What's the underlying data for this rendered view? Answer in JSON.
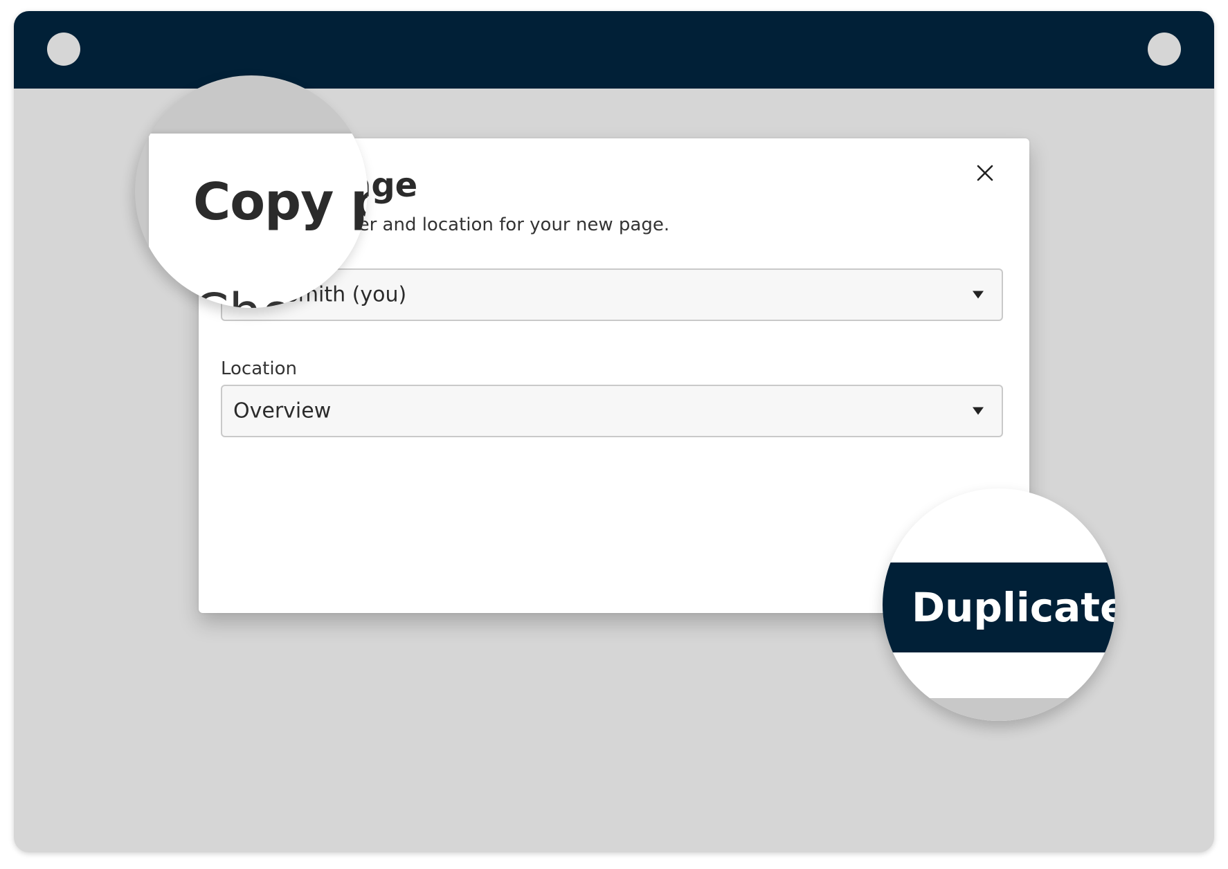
{
  "modal": {
    "title": "Copy page",
    "description": "Choose an owner and location for your new page.",
    "owner_label": "Choose owner",
    "owner_value": "John Smith (you)",
    "location_label": "Location",
    "location_value": "Overview",
    "close_icon": "close-icon",
    "duplicate_label": "Duplicate"
  },
  "colors": {
    "topbar": "#012037",
    "background": "#d6d6d6",
    "button": "#012037"
  }
}
